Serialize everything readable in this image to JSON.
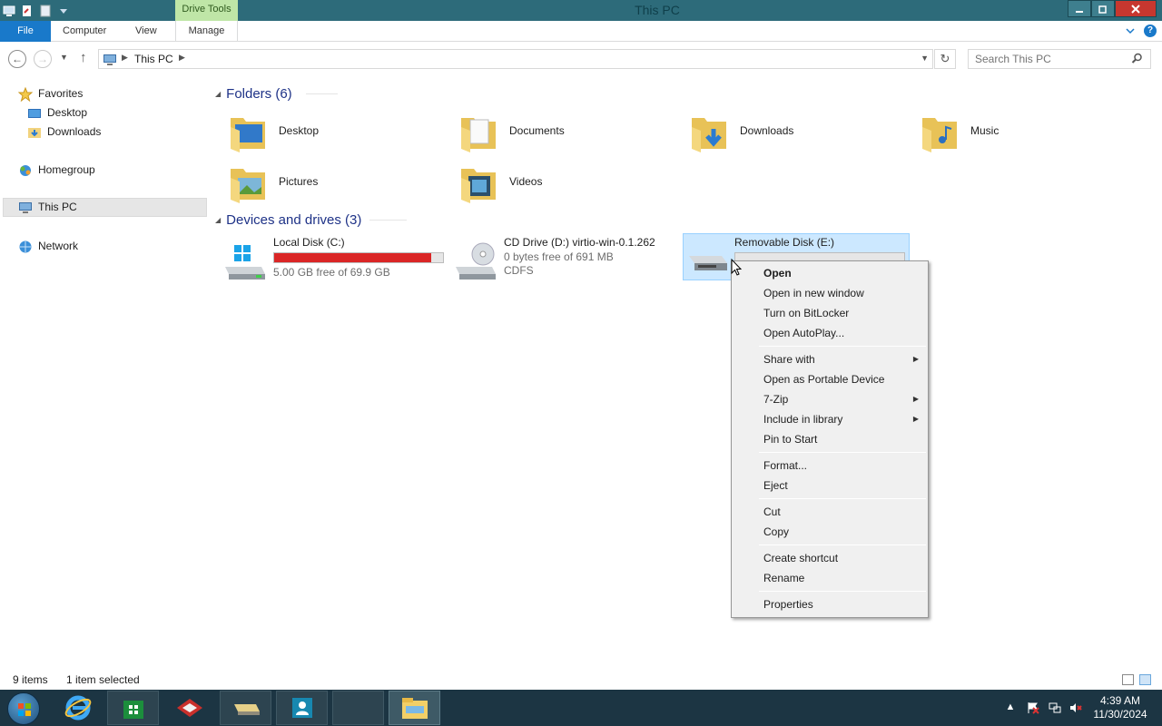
{
  "window": {
    "title": "This PC",
    "contextual_tab_group": "Drive Tools"
  },
  "ribbon": {
    "tabs": [
      "File",
      "Computer",
      "View",
      "Manage"
    ],
    "help": "?"
  },
  "address": {
    "crumb": "This PC",
    "search_placeholder": "Search This PC"
  },
  "nav_pane": {
    "favorites": "Favorites",
    "desktop": "Desktop",
    "downloads": "Downloads",
    "homegroup": "Homegroup",
    "this_pc": "This PC",
    "network": "Network"
  },
  "folders": {
    "header": "Folders (6)",
    "items": [
      "Desktop",
      "Documents",
      "Downloads",
      "Music",
      "Pictures",
      "Videos"
    ]
  },
  "drives": {
    "header": "Devices and drives (3)",
    "items": [
      {
        "name": "Local Disk (C:)",
        "free": "5.00 GB free of 69.9 GB",
        "used_fraction": 0.93
      },
      {
        "name": "CD Drive (D:) virtio-win-0.1.262",
        "free": "0 bytes free of 691 MB",
        "fs": "CDFS"
      },
      {
        "name": "Removable Disk (E:)"
      }
    ]
  },
  "context_menu": {
    "items": [
      "Open",
      "Open in new window",
      "Turn on BitLocker",
      "Open AutoPlay...",
      "Share with",
      "Open as Portable Device",
      "7-Zip",
      "Include in library",
      "Pin to Start",
      "Format...",
      "Eject",
      "Cut",
      "Copy",
      "Create shortcut",
      "Rename",
      "Properties"
    ]
  },
  "status": {
    "items": "9 items",
    "selected": "1 item selected"
  },
  "taskbar": {
    "time": "4:39 AM",
    "date": "11/30/2024"
  },
  "colors": {
    "titlebar": "#2d6b7a",
    "file_tab": "#1979ca",
    "drive_tools": "#bfe6a7",
    "usage_bar": "#da2626",
    "selection": "#cce8ff"
  }
}
